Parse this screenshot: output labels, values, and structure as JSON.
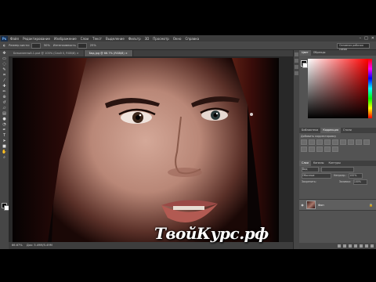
{
  "menu": {
    "logo": "Ps",
    "items": [
      "Файл",
      "Редактирование",
      "Изображение",
      "Слои",
      "Текст",
      "Выделение",
      "Фильтр",
      "3D",
      "Просмотр",
      "Окно",
      "Справка"
    ]
  },
  "options": {
    "size_label": "Размер кисти:",
    "size_value": "50%",
    "dir_label": "Интенсивность",
    "dir_value": "25%",
    "workspace": "Основная рабочая среда"
  },
  "tabs": [
    {
      "label": "Безымянный-1.psd @ 100% (Слой 0, RGB/8) ×"
    },
    {
      "label": "Бвд.jpg @ 66.7% (RGB/8) ×"
    }
  ],
  "status": {
    "zoom": "66.67%",
    "doc": "Док: 5.49M/5.49M"
  },
  "watermark": "ТвойКурс.рф",
  "panels": {
    "color_tabs": [
      "Цвет",
      "Образцы"
    ],
    "adj_tabs": [
      "Библиотеки",
      "Коррекция",
      "Стили"
    ],
    "adj_label": "Добавить корректировку",
    "layers_tabs": [
      "Слои",
      "Каналы",
      "Контуры"
    ],
    "layers_kind": "Вид",
    "layers_mode": "Обычные",
    "opacity_label": "Непрозр.:",
    "opacity_value": "100%",
    "lock_label": "Закрепить:",
    "fill_label": "Заливка:",
    "fill_value": "100%",
    "layer_name": "Фон"
  },
  "colors": {
    "menubar": "#3c3c3c",
    "workspace": "#535353",
    "fg": "#000000",
    "bg": "#ffffff"
  }
}
